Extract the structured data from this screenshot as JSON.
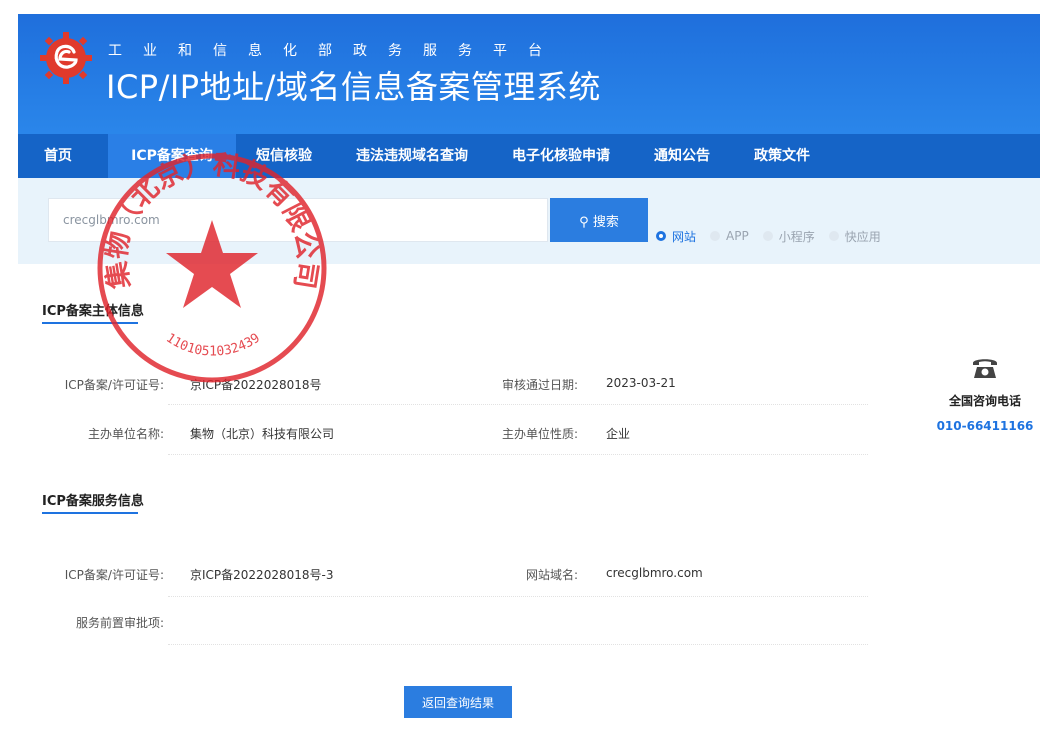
{
  "header": {
    "subtitle": "工业和信息化部政务服务平台",
    "title": "ICP/IP地址/域名信息备案管理系统"
  },
  "nav": {
    "items": [
      {
        "label": "首页"
      },
      {
        "label": "ICP备案查询"
      },
      {
        "label": "短信核验"
      },
      {
        "label": "违法违规域名查询"
      },
      {
        "label": "电子化核验申请"
      },
      {
        "label": "通知公告"
      },
      {
        "label": "政策文件"
      }
    ],
    "active_index": 1
  },
  "search": {
    "input_value": "crecglbmro.com",
    "button_label": "搜索",
    "types": [
      {
        "label": "网站",
        "selected": true
      },
      {
        "label": "APP",
        "selected": false
      },
      {
        "label": "小程序",
        "selected": false
      },
      {
        "label": "快应用",
        "selected": false
      }
    ]
  },
  "subject_info": {
    "title": "ICP备案主体信息",
    "license_label": "ICP备案/许可证号:",
    "license_value": "京ICP备2022028018号",
    "approval_date_label": "审核通过日期:",
    "approval_date_value": "2023-03-21",
    "org_name_label": "主办单位名称:",
    "org_name_value": "集物（北京）科技有限公司",
    "org_type_label": "主办单位性质:",
    "org_type_value": "企业"
  },
  "service_info": {
    "title": "ICP备案服务信息",
    "license_label": "ICP备案/许可证号:",
    "license_value": "京ICP备2022028018号-3",
    "domain_label": "网站域名:",
    "domain_value": "crecglbmro.com",
    "preapproval_label": "服务前置审批项:",
    "preapproval_value": ""
  },
  "hotline": {
    "icon": "telephone-icon",
    "label": "全国咨询电话",
    "number": "010-66411166"
  },
  "back_button_label": "返回查询结果",
  "stamp": {
    "text": "集物（北京）科技有限公司",
    "code": "1101051032439",
    "color": "#e0242c"
  },
  "colors": {
    "header_blue": "#2a86ea",
    "nav_blue": "#1564c7",
    "accent": "#1e73e0",
    "logo_red": "#e03a2c"
  }
}
